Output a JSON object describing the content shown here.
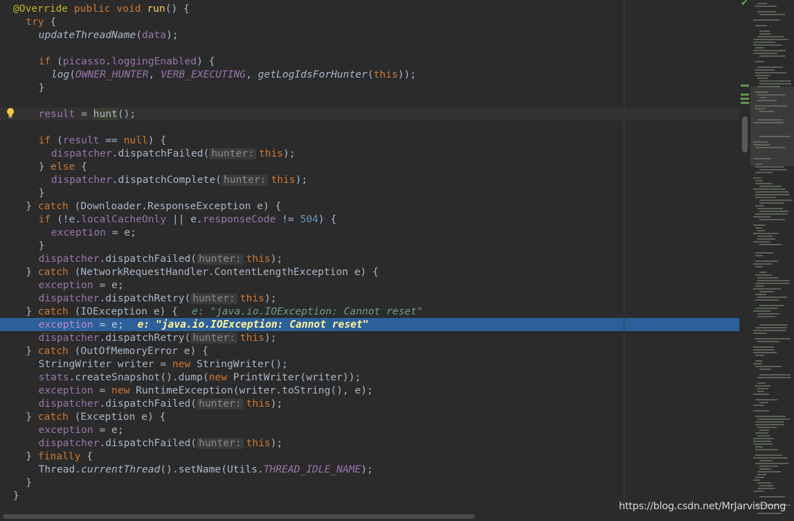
{
  "colors": {
    "background": "#2b2b2b",
    "keyword": "#cc7832",
    "annotation": "#bbb529",
    "method": "#ffc66d",
    "field": "#9876aa",
    "number": "#6897bb",
    "text": "#a9b7c6",
    "execution_line": "#2d5f9a",
    "debug_value": "#6e9c8a"
  },
  "editor": {
    "lines": [
      {
        "indent": 0,
        "tokens": [
          {
            "t": "@Override",
            "c": "ann"
          },
          {
            "t": " "
          },
          {
            "t": "public",
            "c": "kw"
          },
          {
            "t": " "
          },
          {
            "t": "void",
            "c": "kw"
          },
          {
            "t": " "
          },
          {
            "t": "run",
            "c": "fn"
          },
          {
            "t": "() {"
          }
        ]
      },
      {
        "indent": 1,
        "tokens": [
          {
            "t": "try",
            "c": "kw"
          },
          {
            "t": " {"
          }
        ]
      },
      {
        "indent": 2,
        "tokens": [
          {
            "t": "updateThreadName",
            "c": "istatic"
          },
          {
            "t": "("
          },
          {
            "t": "data",
            "c": "field"
          },
          {
            "t": ");"
          }
        ]
      },
      {
        "indent": 0,
        "tokens": []
      },
      {
        "indent": 2,
        "tokens": [
          {
            "t": "if",
            "c": "kw"
          },
          {
            "t": " ("
          },
          {
            "t": "picasso",
            "c": "field"
          },
          {
            "t": "."
          },
          {
            "t": "loggingEnabled",
            "c": "field"
          },
          {
            "t": ") {"
          }
        ]
      },
      {
        "indent": 3,
        "tokens": [
          {
            "t": "log",
            "c": "istatic"
          },
          {
            "t": "("
          },
          {
            "t": "OWNER_HUNTER",
            "c": "static"
          },
          {
            "t": ", "
          },
          {
            "t": "VERB_EXECUTING",
            "c": "static"
          },
          {
            "t": ", "
          },
          {
            "t": "getLogIdsForHunter",
            "c": "istatic"
          },
          {
            "t": "("
          },
          {
            "t": "this",
            "c": "kw"
          },
          {
            "t": "));"
          }
        ]
      },
      {
        "indent": 2,
        "tokens": [
          {
            "t": "}"
          }
        ]
      },
      {
        "indent": 0,
        "tokens": []
      },
      {
        "indent": 2,
        "caret": true,
        "tokens": [
          {
            "t": "result",
            "c": "field"
          },
          {
            "t": " = "
          },
          {
            "t": "hunt",
            "c": "hl"
          },
          {
            "t": "();"
          }
        ]
      },
      {
        "indent": 0,
        "tokens": []
      },
      {
        "indent": 2,
        "tokens": [
          {
            "t": "if",
            "c": "kw"
          },
          {
            "t": " ("
          },
          {
            "t": "result",
            "c": "field"
          },
          {
            "t": " == "
          },
          {
            "t": "null",
            "c": "kw"
          },
          {
            "t": ") {"
          }
        ]
      },
      {
        "indent": 3,
        "tokens": [
          {
            "t": "dispatcher",
            "c": "field"
          },
          {
            "t": ".dispatchFailed("
          },
          {
            "t": "hunter:",
            "c": "hint"
          },
          {
            "t": "this",
            "c": "kw"
          },
          {
            "t": ");"
          }
        ]
      },
      {
        "indent": 2,
        "tokens": [
          {
            "t": "} "
          },
          {
            "t": "else",
            "c": "kw"
          },
          {
            "t": " {"
          }
        ]
      },
      {
        "indent": 3,
        "tokens": [
          {
            "t": "dispatcher",
            "c": "field"
          },
          {
            "t": ".dispatchComplete("
          },
          {
            "t": "hunter:",
            "c": "hint"
          },
          {
            "t": "this",
            "c": "kw"
          },
          {
            "t": ");"
          }
        ]
      },
      {
        "indent": 2,
        "tokens": [
          {
            "t": "}"
          }
        ]
      },
      {
        "indent": 1,
        "tokens": [
          {
            "t": "} "
          },
          {
            "t": "catch",
            "c": "kw"
          },
          {
            "t": " (Downloader.ResponseException e) {"
          }
        ]
      },
      {
        "indent": 2,
        "tokens": [
          {
            "t": "if",
            "c": "kw"
          },
          {
            "t": " (!e."
          },
          {
            "t": "localCacheOnly",
            "c": "field"
          },
          {
            "t": " || e."
          },
          {
            "t": "responseCode",
            "c": "field"
          },
          {
            "t": " != "
          },
          {
            "t": "504",
            "c": "num"
          },
          {
            "t": ") {"
          }
        ]
      },
      {
        "indent": 3,
        "tokens": [
          {
            "t": "exception",
            "c": "field"
          },
          {
            "t": " = e;"
          }
        ]
      },
      {
        "indent": 2,
        "tokens": [
          {
            "t": "}"
          }
        ]
      },
      {
        "indent": 2,
        "tokens": [
          {
            "t": "dispatcher",
            "c": "field"
          },
          {
            "t": ".dispatchFailed("
          },
          {
            "t": "hunter:",
            "c": "hint"
          },
          {
            "t": "this",
            "c": "kw"
          },
          {
            "t": ");"
          }
        ]
      },
      {
        "indent": 1,
        "tokens": [
          {
            "t": "} "
          },
          {
            "t": "catch",
            "c": "kw"
          },
          {
            "t": " (NetworkRequestHandler.ContentLengthException e) {"
          }
        ]
      },
      {
        "indent": 2,
        "tokens": [
          {
            "t": "exception",
            "c": "field"
          },
          {
            "t": " = e;"
          }
        ]
      },
      {
        "indent": 2,
        "tokens": [
          {
            "t": "dispatcher",
            "c": "field"
          },
          {
            "t": ".dispatchRetry("
          },
          {
            "t": "hunter:",
            "c": "hint"
          },
          {
            "t": "this",
            "c": "kw"
          },
          {
            "t": ");"
          }
        ]
      },
      {
        "indent": 1,
        "tokens": [
          {
            "t": "} "
          },
          {
            "t": "catch",
            "c": "kw"
          },
          {
            "t": " (IOException e) {"
          },
          {
            "t": "e: \"java.io.IOException: Cannot reset\"",
            "c": "debug"
          }
        ]
      },
      {
        "indent": 2,
        "exec": true,
        "tokens": [
          {
            "t": "exception",
            "c": "field"
          },
          {
            "t": " = e;"
          },
          {
            "t": "e: \"java.io.IOException: Cannot reset\"",
            "c": "debugexec"
          }
        ]
      },
      {
        "indent": 2,
        "tokens": [
          {
            "t": "dispatcher",
            "c": "field"
          },
          {
            "t": ".dispatchRetry("
          },
          {
            "t": "hunter:",
            "c": "hint"
          },
          {
            "t": "this",
            "c": "kw"
          },
          {
            "t": ");"
          }
        ]
      },
      {
        "indent": 1,
        "tokens": [
          {
            "t": "} "
          },
          {
            "t": "catch",
            "c": "kw"
          },
          {
            "t": " (OutOfMemoryError e) {"
          }
        ]
      },
      {
        "indent": 2,
        "tokens": [
          {
            "t": "StringWriter writer = "
          },
          {
            "t": "new",
            "c": "kw"
          },
          {
            "t": " StringWriter();"
          }
        ]
      },
      {
        "indent": 2,
        "tokens": [
          {
            "t": "stats",
            "c": "field"
          },
          {
            "t": ".createSnapshot().dump("
          },
          {
            "t": "new",
            "c": "kw"
          },
          {
            "t": " PrintWriter(writer));"
          }
        ]
      },
      {
        "indent": 2,
        "tokens": [
          {
            "t": "exception",
            "c": "field"
          },
          {
            "t": " = "
          },
          {
            "t": "new",
            "c": "kw"
          },
          {
            "t": " RuntimeException(writer.toString(), e);"
          }
        ]
      },
      {
        "indent": 2,
        "tokens": [
          {
            "t": "dispatcher",
            "c": "field"
          },
          {
            "t": ".dispatchFailed("
          },
          {
            "t": "hunter:",
            "c": "hint"
          },
          {
            "t": "this",
            "c": "kw"
          },
          {
            "t": ");"
          }
        ]
      },
      {
        "indent": 1,
        "tokens": [
          {
            "t": "} "
          },
          {
            "t": "catch",
            "c": "kw"
          },
          {
            "t": " (Exception e) {"
          }
        ]
      },
      {
        "indent": 2,
        "tokens": [
          {
            "t": "exception",
            "c": "field"
          },
          {
            "t": " = e;"
          }
        ]
      },
      {
        "indent": 2,
        "tokens": [
          {
            "t": "dispatcher",
            "c": "field"
          },
          {
            "t": ".dispatchFailed("
          },
          {
            "t": "hunter:",
            "c": "hint"
          },
          {
            "t": "this",
            "c": "kw"
          },
          {
            "t": ");"
          }
        ]
      },
      {
        "indent": 1,
        "tokens": [
          {
            "t": "} "
          },
          {
            "t": "finally",
            "c": "kw"
          },
          {
            "t": " {"
          }
        ]
      },
      {
        "indent": 2,
        "tokens": [
          {
            "t": "Thread."
          },
          {
            "t": "currentThread",
            "c": "istatic"
          },
          {
            "t": "().setName(Utils."
          },
          {
            "t": "THREAD_IDLE_NAME",
            "c": "static"
          },
          {
            "t": ");"
          }
        ]
      },
      {
        "indent": 1,
        "tokens": [
          {
            "t": "}"
          }
        ]
      },
      {
        "indent": 0,
        "tokens": [
          {
            "t": "}"
          }
        ]
      }
    ]
  },
  "icons": {
    "gutter": "lightbulb-icon",
    "status": "check-icon"
  },
  "watermark": "https://blog.csdn.net/MrJarvisDong"
}
